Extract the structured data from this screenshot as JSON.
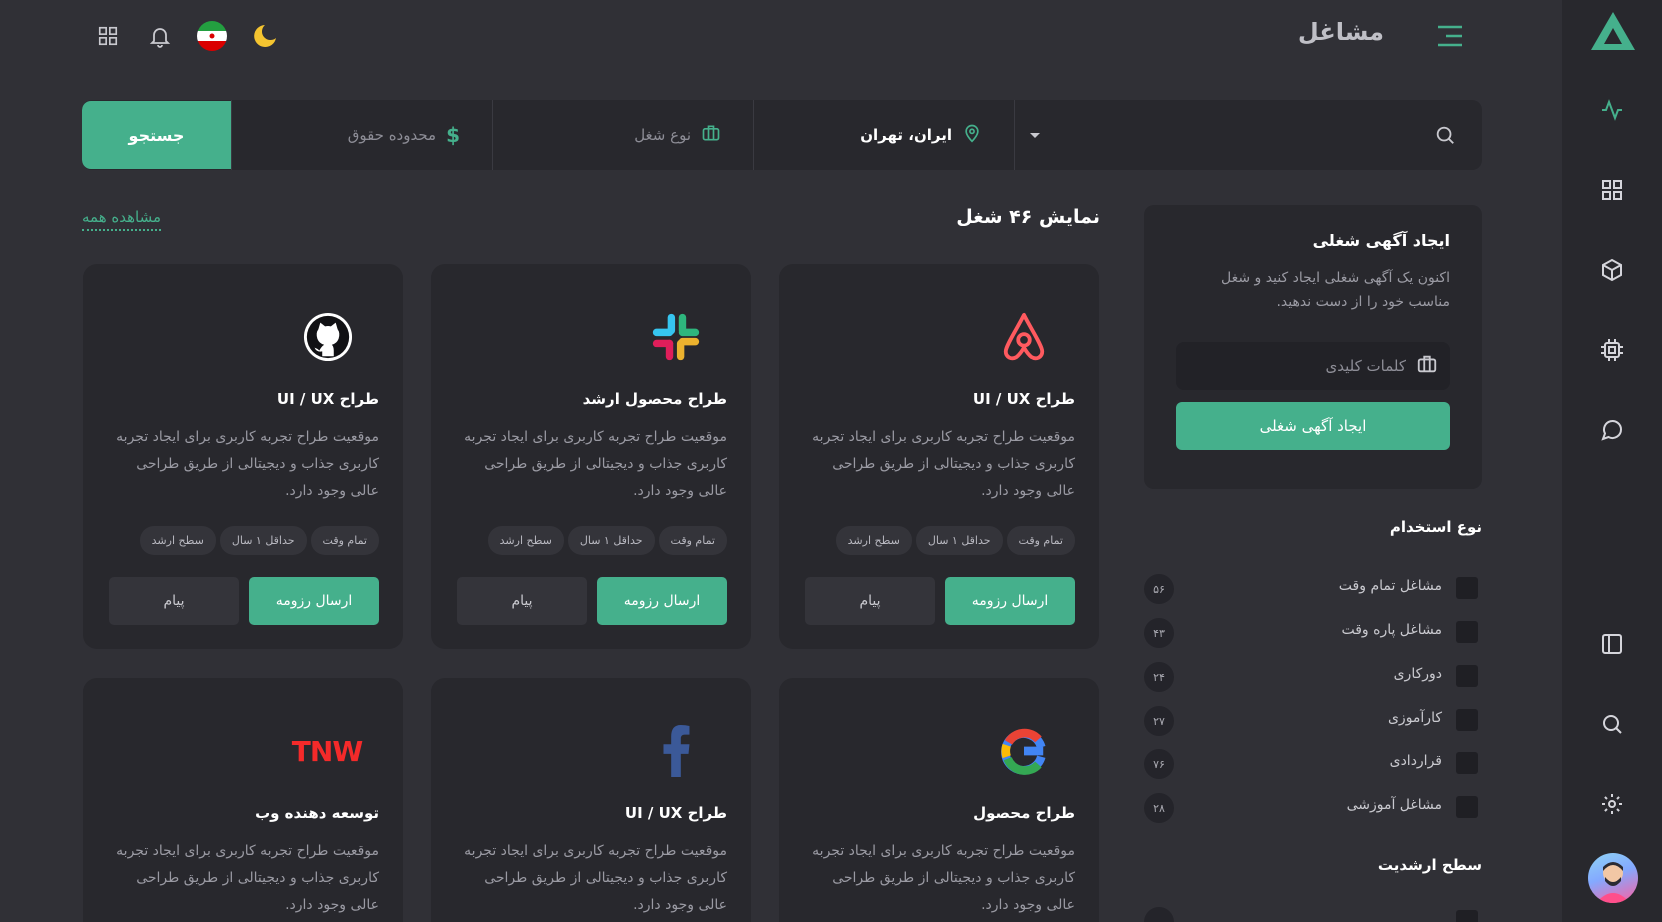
{
  "header": {
    "title": "مشاغل"
  },
  "search": {
    "keyword_placeholder": "",
    "location": "ایران، تهران",
    "job_type": "نوع شغل",
    "salary": "محدوده حقوق",
    "button": "جستجو"
  },
  "create_panel": {
    "title": "ایجاد آگهی شغلی",
    "description": "اکنون یک آگهی شغلی ایجاد کنید و شغل مناسب خود را از دست ندهید.",
    "keyword_placeholder": "کلمات کلیدی",
    "button": "ایجاد آگهی شغلی"
  },
  "filters": {
    "employment_title": "نوع استخدام",
    "employment": [
      {
        "label": "مشاغل تمام وقت",
        "count": "۵۶"
      },
      {
        "label": "مشاغل پاره وقت",
        "count": "۴۳"
      },
      {
        "label": "دورکاری",
        "count": "۲۴"
      },
      {
        "label": "کارآموزی",
        "count": "۲۷"
      },
      {
        "label": "قراردادی",
        "count": "۷۶"
      },
      {
        "label": "مشاغل آموزشی",
        "count": "۲۸"
      }
    ],
    "seniority_title": "سطح ارشدیت"
  },
  "jobs": {
    "count_label": "نمایش ۴۶ شغل",
    "view_all": "مشاهده همه",
    "cards": [
      {
        "logo": "airbnb-logo",
        "title": "طراح UI / UX",
        "desc": "موقعیت طراح تجربه کاربری برای ایجاد تجربه کاربری جذاب و دیجیتالی از طریق طراحی عالی وجود دارد.",
        "tags": [
          "تمام وقت",
          "حداقل ۱ سال",
          "سطح ارشد"
        ],
        "apply": "ارسال رزومه",
        "message": "پیام"
      },
      {
        "logo": "slack-logo",
        "title": "طراح محصول ارشد",
        "desc": "موقعیت طراح تجربه کاربری برای ایجاد تجربه کاربری جذاب و دیجیتالی از طریق طراحی عالی وجود دارد.",
        "tags": [
          "تمام وقت",
          "حداقل ۱ سال",
          "سطح ارشد"
        ],
        "apply": "ارسال رزومه",
        "message": "پیام"
      },
      {
        "logo": "github-logo",
        "title": "طراح UI / UX",
        "desc": "موقعیت طراح تجربه کاربری برای ایجاد تجربه کاربری جذاب و دیجیتالی از طریق طراحی عالی وجود دارد.",
        "tags": [
          "تمام وقت",
          "حداقل ۱ سال",
          "سطح ارشد"
        ],
        "apply": "ارسال رزومه",
        "message": "پیام"
      },
      {
        "logo": "google-logo",
        "title": "طراح محصول",
        "desc": "موقعیت طراح تجربه کاربری برای ایجاد تجربه کاربری جذاب و دیجیتالی از طریق طراحی عالی وجود دارد."
      },
      {
        "logo": "facebook-logo",
        "title": "طراح UI / UX",
        "desc": "موقعیت طراح تجربه کاربری برای ایجاد تجربه کاربری جذاب و دیجیتالی از طریق طراحی عالی وجود دارد."
      },
      {
        "logo": "tnw-logo",
        "logo_text": "TNW",
        "title": "توسعه دهنده وب",
        "desc": "موقعیت طراح تجربه کاربری برای ایجاد تجربه کاربری جذاب و دیجیتالی از طریق طراحی عالی وجود دارد."
      }
    ]
  },
  "colors": {
    "accent": "#45b08c",
    "background": "#303036",
    "surface": "#28282d"
  }
}
